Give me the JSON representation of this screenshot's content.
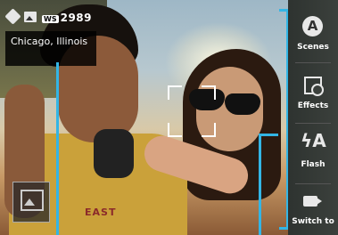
{
  "status": {
    "ws_badge": "WS",
    "shot_count": "2989"
  },
  "location": {
    "text": "Chicago, Illinois"
  },
  "sidebar": {
    "items": [
      {
        "label": "Scenes",
        "icon": "scenes-icon",
        "glyph": "A"
      },
      {
        "label": "Effects",
        "icon": "effects-icon"
      },
      {
        "label": "Flash",
        "icon": "flash-icon",
        "glyph": "ϟA"
      },
      {
        "label": "Switch to",
        "icon": "switch-camera-icon"
      }
    ]
  },
  "photo": {
    "shirt_text": "EAST"
  },
  "colors": {
    "accent": "#33b5e5",
    "sidebar_bg": "#3b403c",
    "focus": "#ffffff"
  }
}
